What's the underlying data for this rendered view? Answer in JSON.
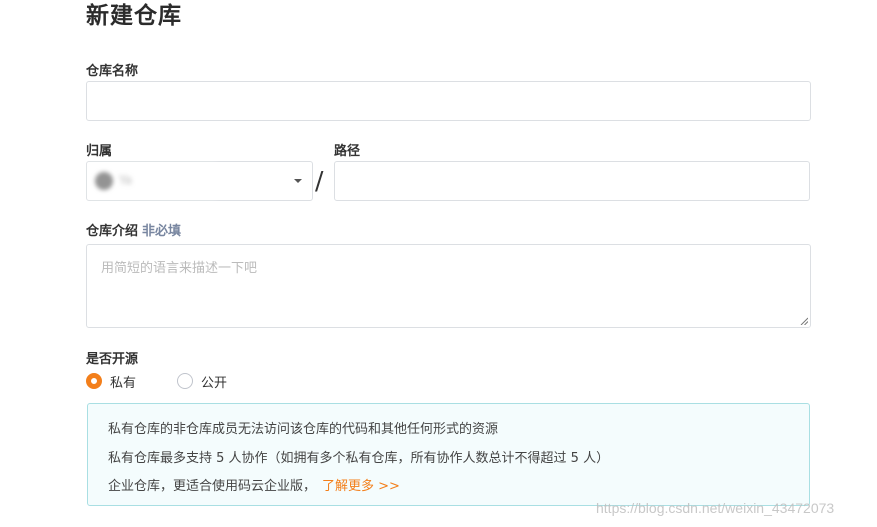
{
  "page": {
    "title": "新建仓库"
  },
  "form": {
    "repo_name_label": "仓库名称",
    "repo_name_value": "",
    "owner_label": "归属",
    "owner_value": "Ya",
    "path_label": "路径",
    "path_separator": "/",
    "path_value": "",
    "description_label": "仓库介绍",
    "description_optional_hint": "非必填",
    "description_placeholder": "用简短的语言来描述一下吧",
    "open_source_label": "是否开源",
    "visibility_options": [
      {
        "label": "私有",
        "selected": true
      },
      {
        "label": "公开",
        "selected": false
      }
    ]
  },
  "info_box": {
    "line1": "私有仓库的非仓库成员无法访问该仓库的代码和其他任何形式的资源",
    "line2": "私有仓库最多支持 5 人协作（如拥有多个私有仓库，所有协作人数总计不得超过 5 人）",
    "line3": "企业仓库，更适合使用码云企业版，",
    "learn_more": "了解更多 >>"
  },
  "watermark": "https://blog.csdn.net/weixin_43472073",
  "colors": {
    "accent": "#f37f1b",
    "info_border": "#a9dfe3",
    "info_background": "#f4fcfd",
    "optional_hint": "#7886a0"
  }
}
